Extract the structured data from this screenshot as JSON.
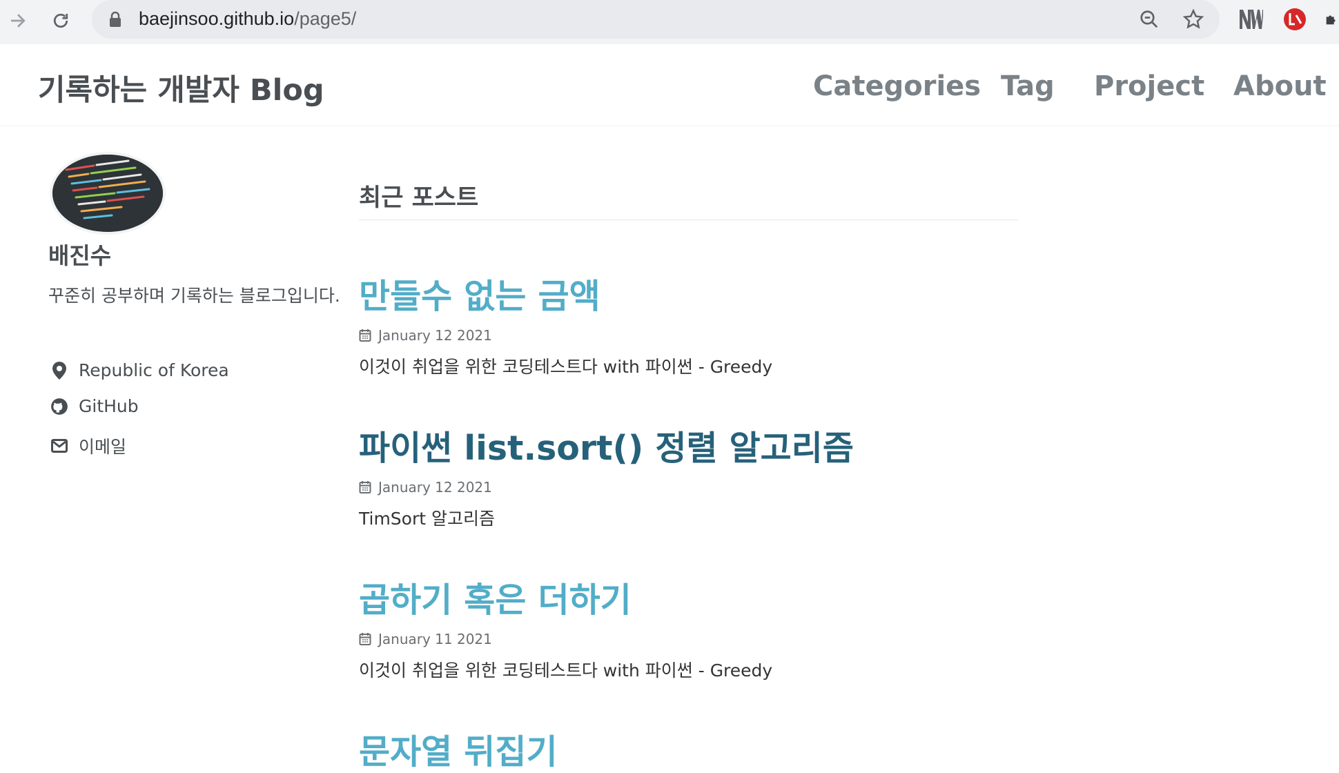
{
  "browser": {
    "url_host": "baejinsoo.github.io",
    "url_path": "/page5/"
  },
  "header": {
    "site_title": "기록하는 개발자 Blog",
    "nav": [
      {
        "label": "Categories"
      },
      {
        "label": "Tag"
      },
      {
        "label": "Project"
      },
      {
        "label": "About"
      }
    ]
  },
  "sidebar": {
    "author_name": "배진수",
    "bio": "꾸준히 공부하며 기록하는 블로그입니다.",
    "links": [
      {
        "label": "Republic of Korea",
        "icon": "map-marker-icon"
      },
      {
        "label": "GitHub",
        "icon": "github-icon"
      },
      {
        "label": "이메일",
        "icon": "envelope-icon"
      }
    ]
  },
  "main": {
    "section_title": "최근 포스트",
    "posts": [
      {
        "title": "만들수 없는 금액",
        "date": "January 12 2021",
        "excerpt": "이것이 취업을 위한 코딩테스트다 with 파이썬 - Greedy"
      },
      {
        "title": "파이썬 list.sort() 정렬 알고리즘",
        "date": "January 12 2021",
        "excerpt": "TimSort 알고리즘"
      },
      {
        "title": "곱하기 혹은 더하기",
        "date": "January 11 2021",
        "excerpt": "이것이 취업을 위한 코딩테스트다 with 파이썬 - Greedy"
      },
      {
        "title": "문자열 뒤집기",
        "date": "",
        "excerpt": ""
      }
    ]
  },
  "colors": {
    "link": "#52adc8",
    "link_hover": "#26617a",
    "text": "#494e52"
  }
}
